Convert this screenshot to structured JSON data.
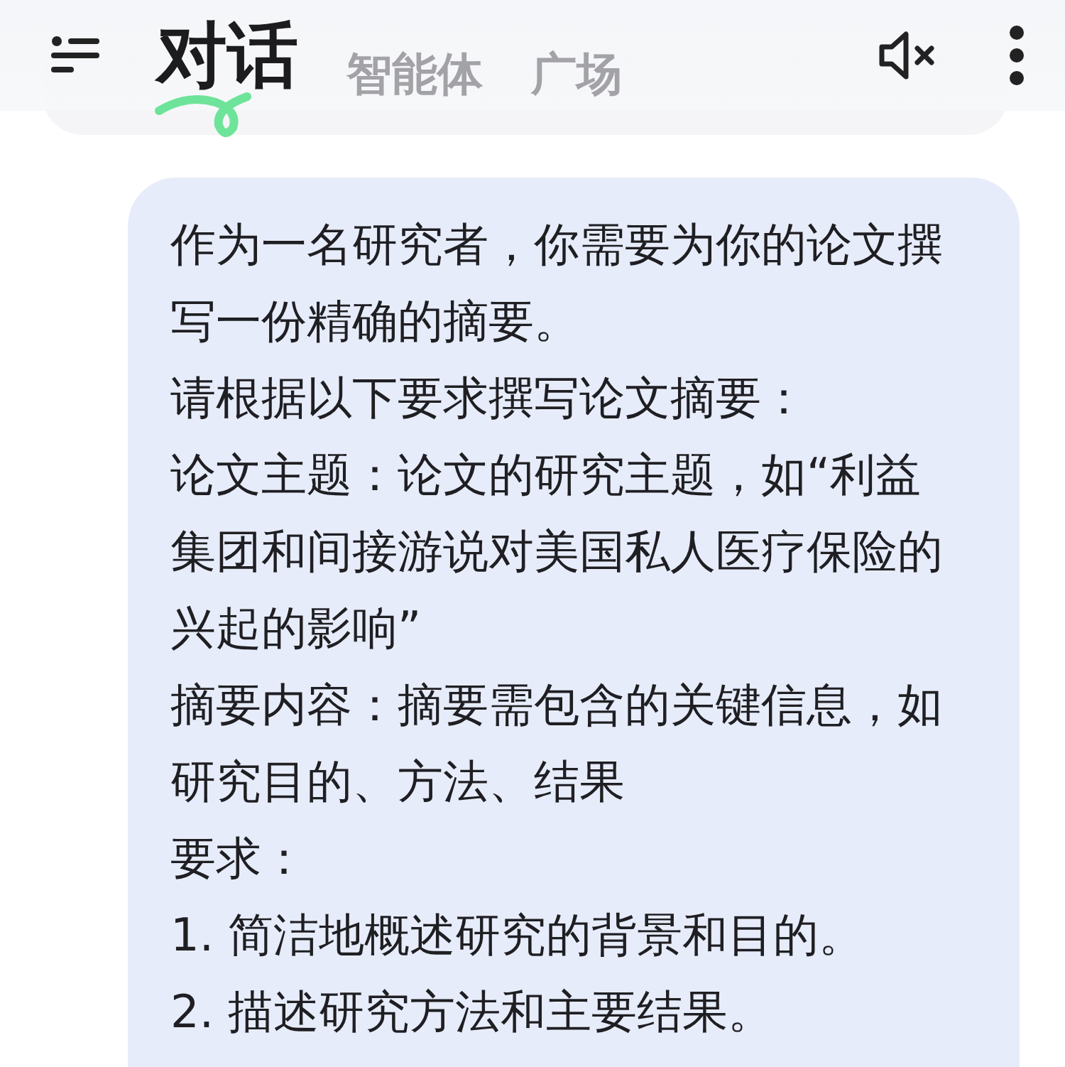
{
  "tabs": [
    {
      "label": "对话",
      "selected": true
    },
    {
      "label": "智能体",
      "selected": false
    },
    {
      "label": "广场",
      "selected": false
    }
  ],
  "message": {
    "paragraphs": [
      "作为一名研究者，你需要为你的论文撰写一份精确的摘要。",
      "请根据以下要求撰写论文摘要：",
      "论文主题：论文的研究主题，如“利益集团和间接游说对美国私人医疗保险的兴起的影响”",
      "摘要内容：摘要需包含的关键信息，如研究目的、方法、结果",
      "要求：",
      "1. 简洁地概述研究的背景和目的。",
      "2. 描述研究方法和主要结果。"
    ]
  }
}
